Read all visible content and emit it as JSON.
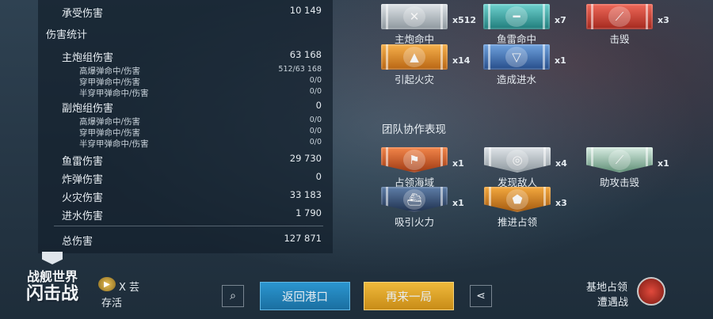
{
  "stats": {
    "received_damage": {
      "label": "承受伤害",
      "value": "10 149"
    },
    "section_title": "伤害统计",
    "main_battery": {
      "label": "主炮组伤害",
      "value": "63 168"
    },
    "main_sub": [
      {
        "label": "高爆弹命中/伤害",
        "value": "512/63 168"
      },
      {
        "label": "穿甲弹命中/伤害",
        "value": "0/0"
      },
      {
        "label": "半穿甲弹命中/伤害",
        "value": "0/0"
      }
    ],
    "secondary": {
      "label": "副炮组伤害",
      "value": "0"
    },
    "secondary_sub": [
      {
        "label": "高爆弹命中/伤害",
        "value": "0/0"
      },
      {
        "label": "穿甲弹命中/伤害",
        "value": "0/0"
      },
      {
        "label": "半穿甲弹命中/伤害",
        "value": "0/0"
      }
    ],
    "torpedo": {
      "label": "鱼雷伤害",
      "value": "29 730"
    },
    "bomb": {
      "label": "炸弹伤害",
      "value": "0"
    },
    "fire": {
      "label": "火灾伤害",
      "value": "33 183"
    },
    "flood": {
      "label": "进水伤害",
      "value": "1 790"
    },
    "total": {
      "label": "总伤害",
      "value": "127 871"
    }
  },
  "medals": [
    {
      "label": "主炮命中",
      "count": "x512",
      "color": "silver",
      "icon": "crossed-shells-icon"
    },
    {
      "label": "鱼雷命中",
      "count": "x7",
      "color": "teal",
      "icon": "torpedo-icon"
    },
    {
      "label": "击毁",
      "count": "x3",
      "color": "red",
      "icon": "sinking-ship-icon"
    },
    {
      "label": "引起火灾",
      "count": "x14",
      "color": "orange",
      "icon": "fire-icon"
    },
    {
      "label": "造成进水",
      "count": "x1",
      "color": "blue",
      "icon": "flood-icon"
    }
  ],
  "team": {
    "title": "团队协作表现",
    "medals": [
      {
        "label": "占领海域",
        "count": "x1",
        "icon": "flag-icon"
      },
      {
        "label": "发现敌人",
        "count": "x4",
        "icon": "radar-icon"
      },
      {
        "label": "助攻击毁",
        "count": "x1",
        "icon": "assist-icon"
      },
      {
        "label": "吸引火力",
        "count": "x1",
        "icon": "ship-icon"
      },
      {
        "label": "推进占领",
        "count": "x3",
        "icon": "capture-icon"
      }
    ]
  },
  "logo": {
    "line1": "战舰世界",
    "line2": "闪击战"
  },
  "player": {
    "name": "X 芸",
    "status": "存活"
  },
  "buttons": {
    "back": "返回港口",
    "again": "再来一局"
  },
  "mode": {
    "line1": "基地占领",
    "line2": "遭遇战"
  },
  "colors": {
    "accent_blue": "#1f7fb8",
    "accent_gold": "#d9a42a"
  }
}
